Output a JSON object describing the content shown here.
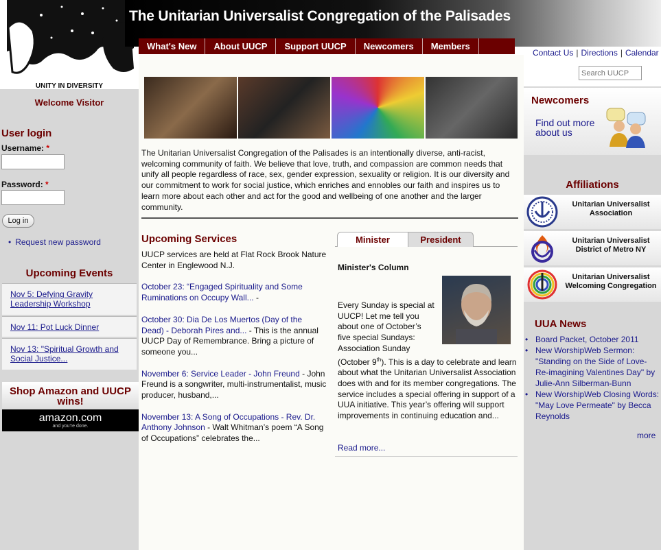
{
  "header": {
    "title": "The Unitarian Universalist Congregation of the Palisades",
    "logo_caption": "UNITY IN DIVERSITY"
  },
  "main_nav": [
    "What's New",
    "About UUCP",
    "Support UUCP",
    "Newcomers",
    "Members"
  ],
  "util_links": [
    "Contact Us",
    "Directions",
    "Calendar"
  ],
  "search": {
    "placeholder": "Search UUCP"
  },
  "left": {
    "welcome": "Welcome Visitor",
    "login_title": "User login",
    "username_label": "Username:",
    "password_label": "Password:",
    "required_mark": "*",
    "login_button": "Log in",
    "request_password": "Request new password",
    "events_title": "Upcoming Events",
    "events": [
      "Nov 5: Defying Gravity Leadership Workshop",
      "Nov 11: Pot Luck Dinner",
      "Nov 13: \"Spiritual Growth and Social Justice..."
    ],
    "amazon_promo": "Shop Amazon and UUCP wins!",
    "amazon_logo": "amazon.com",
    "amazon_tag": "and you're done."
  },
  "center": {
    "intro": "The Unitarian Universalist Congregation of the Palisades is an intentionally diverse, anti-racist, welcoming community of faith. We believe that love, truth, and compassion are common needs that unify all people regardless of race, sex, gender expression, sexuality or religion.  It is our diversity and our commitment to work for social justice, which enriches and ennobles our faith and inspires us to learn more about each other and act for the good and wellbeing of one another and the larger community.",
    "services_title": "Upcoming Services",
    "services_intro": "UUCP services are held at Flat Rock Brook Nature Center in Englewood N.J.",
    "services": [
      {
        "link": "October 23: “Engaged Spirituality and Some Ruminations on Occupy Wall...",
        "text": " -"
      },
      {
        "link": "October 30: Dia De Los Muertos (Day of the Dead) - Deborah Pires and...",
        "text": " - This is the annual UUCP Day of Remembrance.  Bring a picture of someone you..."
      },
      {
        "link": "November 6: Service Leader - John Freund",
        "text": " - John Freund is a songwriter, multi-instrumentalist, music producer, husband,..."
      },
      {
        "link": "November 13: A Song of Occupations - Rev. Dr. Anthony Johnson",
        "text": " - Walt Whitman’s poem “A Song of Occupations” celebrates the..."
      }
    ],
    "tabs": [
      "Minister",
      "President"
    ],
    "column_title": "Minister's Column",
    "column_lines": [
      "Every Sunday is special at",
      "UUCP! Let me tell you",
      "about one of October’s",
      "five special Sundays:",
      "Association Sunday"
    ],
    "column_date": "(October 9",
    "column_sup": "th",
    "column_rest": "). This is a day to celebrate and learn about what the Unitarian Universalist Association does with and for its member congregations. The service includes a special offering in support of a UUA initiative. This year’s offering will support improvements in continuing education and...",
    "read_more": "Read more..."
  },
  "right": {
    "newcomers_title": "Newcomers",
    "newcomers_link": "Find out more about us",
    "affiliations_title": "Affiliations",
    "affiliations": [
      "Unitarian Universalist Association",
      "Unitarian Universalist District of Metro NY",
      "Unitarian Universalist Welcoming Congregation"
    ],
    "uua_title": "UUA News",
    "uua_news": [
      "Board Packet, October 2011",
      "New WorshipWeb Sermon: \"Standing on the Side of Love- Re-imagining Valentines Day\" by Julie-Ann Silberman-Bunn",
      "New WorshipWeb Closing Words: \"May Love Permeate\" by Becca Reynolds"
    ],
    "more": "more"
  },
  "colors": {
    "maroon": "#6b0000",
    "link": "#1a1a8c",
    "sidebar": "#d7d7d7"
  }
}
